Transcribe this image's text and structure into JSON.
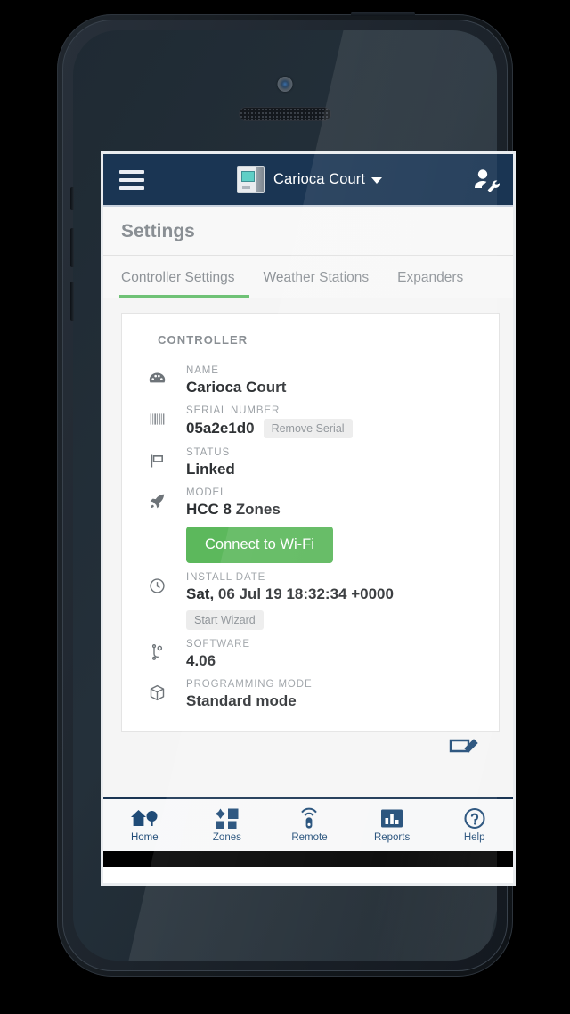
{
  "navbar": {
    "menu_icon": "hamburger-menu-icon",
    "controller_icon": "controller-device-icon",
    "title": "Carioca Court",
    "dropdown_icon": "chevron-down-icon",
    "account_icon": "user-wrench-icon",
    "background_color": "#1a3553"
  },
  "page": {
    "title": "Settings",
    "background_color": "#f5f5f5"
  },
  "tabs": {
    "active_index": 0,
    "accent_color": "#6fc276",
    "items": [
      {
        "label": "Controller Settings"
      },
      {
        "label": "Weather Stations"
      },
      {
        "label": "Expanders"
      }
    ]
  },
  "card": {
    "heading": "CONTROLLER",
    "rows": [
      {
        "icon": "gauge-icon",
        "label": "NAME",
        "value": "Carioca Court"
      },
      {
        "icon": "barcode-icon",
        "label": "SERIAL NUMBER",
        "value": "05a2e1d0",
        "chip": "Remove Serial"
      },
      {
        "icon": "flag-icon",
        "label": "STATUS",
        "value": "Linked"
      },
      {
        "icon": "rocket-icon",
        "label": "MODEL",
        "value": "HCC 8 Zones",
        "button": "Connect to Wi-Fi",
        "button_color": "#5cb85c"
      },
      {
        "icon": "clock-icon",
        "label": "INSTALL DATE",
        "value": "Sat, 06 Jul 19 18:32:34 +0000",
        "chip": "Start Wizard"
      },
      {
        "icon": "code-branch-icon",
        "label": "SOFTWARE",
        "value": "4.06"
      },
      {
        "icon": "cube-icon",
        "label": "PROGRAMMING MODE",
        "value": "Standard mode"
      }
    ],
    "edit_icon": "edit-pencil-icon"
  },
  "tabbar": {
    "color": "#1f4b77",
    "items": [
      {
        "icon": "home-tree-icon",
        "label": "Home"
      },
      {
        "icon": "zones-grid-icon",
        "label": "Zones"
      },
      {
        "icon": "remote-icon",
        "label": "Remote"
      },
      {
        "icon": "reports-bar-chart-icon",
        "label": "Reports"
      },
      {
        "icon": "help-question-icon",
        "label": "Help"
      }
    ]
  }
}
